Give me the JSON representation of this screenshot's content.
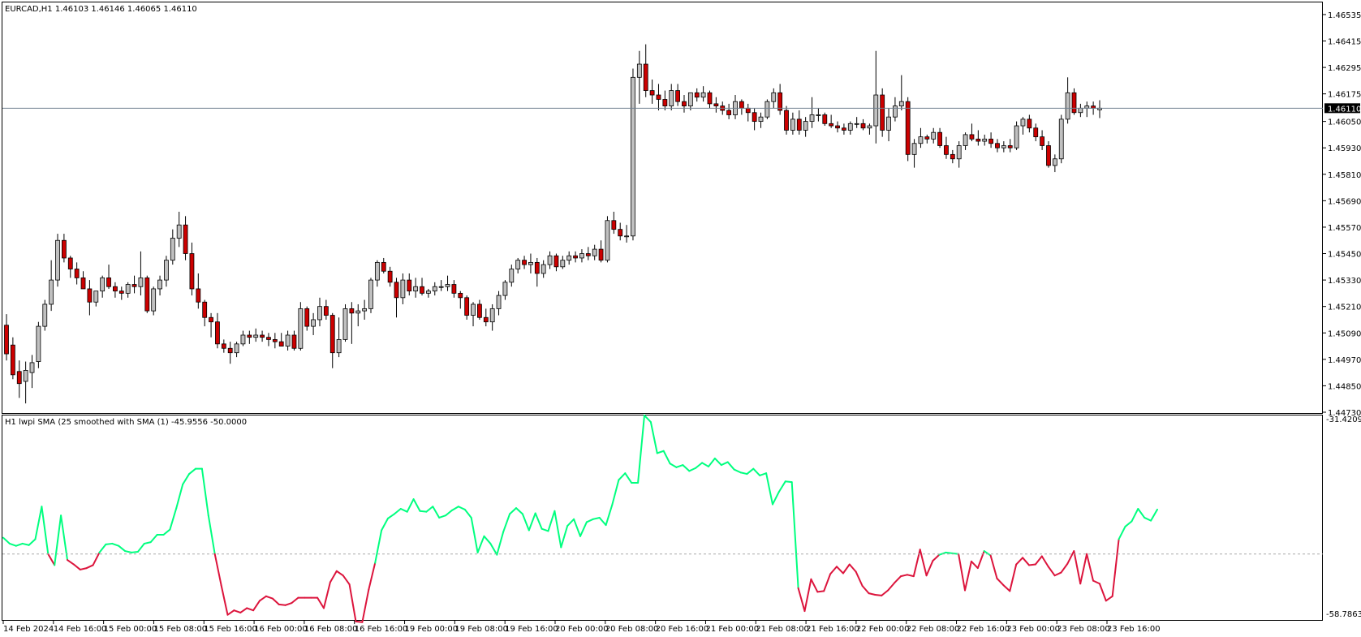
{
  "window": {
    "symbol_info": "EURCAD,H1  1.46103 1.46146 1.46065 1.46110"
  },
  "indicator": {
    "title": "H1 lwpi  SMA (25 smoothed with  SMA (1) -45.9556 -50.0000",
    "scale_max": "-31.4209",
    "scale_min": "-58.7863",
    "levels": [
      -31.4209,
      -58.7863
    ],
    "zero_level": -50.0,
    "up_color": "#00ff7f",
    "down_color": "#dc143c"
  },
  "price_axis": {
    "labels": [
      "1.46535",
      "1.46415",
      "1.46295",
      "1.46175",
      "1.46050",
      "1.45930",
      "1.45810",
      "1.45690",
      "1.45570",
      "1.45450",
      "1.45330",
      "1.45210",
      "1.45090",
      "1.44970",
      "1.44850",
      "1.44730"
    ],
    "current_price": "1.46110"
  },
  "time_axis": {
    "labels": [
      "14 Feb 2024",
      "14 Feb 16:00",
      "15 Feb 00:00",
      "15 Feb 08:00",
      "15 Feb 16:00",
      "16 Feb 00:00",
      "16 Feb 08:00",
      "16 Feb 16:00",
      "19 Feb 00:00",
      "19 Feb 08:00",
      "19 Feb 16:00",
      "20 Feb 00:00",
      "20 Feb 08:00",
      "20 Feb 16:00",
      "21 Feb 00:00",
      "21 Feb 08:00",
      "21 Feb 16:00",
      "22 Feb 00:00",
      "22 Feb 08:00",
      "22 Feb 16:00",
      "23 Feb 00:00",
      "23 Feb 08:00",
      "23 Feb 16:00"
    ]
  },
  "chart_data": {
    "type": "candlestick",
    "symbol": "EURCAD",
    "timeframe": "H1",
    "ylim": [
      1.4473,
      1.4659
    ],
    "up_color": "#c0c0c0",
    "down_color": "#cc0000",
    "candles": [
      [
        1.45125,
        1.45175,
        1.44965,
        1.44995
      ],
      [
        1.45035,
        1.4507,
        1.4488,
        1.449
      ],
      [
        1.44915,
        1.44965,
        1.44795,
        1.4486
      ],
      [
        1.4487,
        1.4496,
        1.4477,
        1.4492
      ],
      [
        1.4491,
        1.4499,
        1.4484,
        1.44955
      ],
      [
        1.4496,
        1.4514,
        1.4493,
        1.4512
      ],
      [
        1.4512,
        1.4524,
        1.451,
        1.4522
      ],
      [
        1.4522,
        1.4542,
        1.4519,
        1.4533
      ],
      [
        1.4533,
        1.4554,
        1.453,
        1.4551
      ],
      [
        1.4551,
        1.4554,
        1.4541,
        1.4543
      ],
      [
        1.4543,
        1.4544,
        1.4534,
        1.4538
      ],
      [
        1.4538,
        1.4541,
        1.4531,
        1.4534
      ],
      [
        1.4534,
        1.4537,
        1.4529,
        1.4529
      ],
      [
        1.4529,
        1.4533,
        1.4517,
        1.4523
      ],
      [
        1.4523,
        1.4528,
        1.4521,
        1.4528
      ],
      [
        1.4528,
        1.4535,
        1.4525,
        1.4534
      ],
      [
        1.4534,
        1.454,
        1.4529,
        1.453
      ],
      [
        1.453,
        1.4532,
        1.4525,
        1.4528
      ],
      [
        1.4528,
        1.453,
        1.4524,
        1.4527
      ],
      [
        1.4527,
        1.4532,
        1.4525,
        1.4531
      ],
      [
        1.4531,
        1.4535,
        1.4527,
        1.453
      ],
      [
        1.453,
        1.4546,
        1.4526,
        1.4534
      ],
      [
        1.4534,
        1.4535,
        1.4518,
        1.4519
      ],
      [
        1.4519,
        1.453,
        1.4517,
        1.4529
      ],
      [
        1.4529,
        1.4535,
        1.4526,
        1.4533
      ],
      [
        1.4533,
        1.4544,
        1.453,
        1.4542
      ],
      [
        1.4542,
        1.4556,
        1.454,
        1.4552
      ],
      [
        1.4552,
        1.4564,
        1.4548,
        1.4558
      ],
      [
        1.4558,
        1.4562,
        1.4542,
        1.4545
      ],
      [
        1.4545,
        1.455,
        1.4526,
        1.4529
      ],
      [
        1.4529,
        1.4536,
        1.452,
        1.4523
      ],
      [
        1.4523,
        1.4524,
        1.4512,
        1.4516
      ],
      [
        1.4516,
        1.4518,
        1.4507,
        1.4514
      ],
      [
        1.4514,
        1.4518,
        1.4502,
        1.4504
      ],
      [
        1.4504,
        1.4506,
        1.45,
        1.4502
      ],
      [
        1.4502,
        1.4505,
        1.4495,
        1.45
      ],
      [
        1.45,
        1.4505,
        1.4498,
        1.4504
      ],
      [
        1.4504,
        1.451,
        1.4503,
        1.4508
      ],
      [
        1.4508,
        1.451,
        1.4504,
        1.4507
      ],
      [
        1.4507,
        1.4511,
        1.4505,
        1.4508
      ],
      [
        1.4508,
        1.451,
        1.4505,
        1.4507
      ],
      [
        1.4507,
        1.4509,
        1.4503,
        1.4506
      ],
      [
        1.4506,
        1.4509,
        1.4502,
        1.4505
      ],
      [
        1.4505,
        1.4509,
        1.4503,
        1.4503
      ],
      [
        1.4503,
        1.451,
        1.4501,
        1.4508
      ],
      [
        1.4508,
        1.451,
        1.4501,
        1.4502
      ],
      [
        1.4502,
        1.4523,
        1.4501,
        1.452
      ],
      [
        1.452,
        1.4521,
        1.451,
        1.4512
      ],
      [
        1.4512,
        1.4518,
        1.4508,
        1.4515
      ],
      [
        1.4515,
        1.4525,
        1.4512,
        1.4521
      ],
      [
        1.4521,
        1.4524,
        1.4515,
        1.4517
      ],
      [
        1.4517,
        1.4518,
        1.4493,
        1.45
      ],
      [
        1.45,
        1.4516,
        1.4498,
        1.4506
      ],
      [
        1.4506,
        1.4522,
        1.4505,
        1.452
      ],
      [
        1.452,
        1.4523,
        1.4504,
        1.4518
      ],
      [
        1.4518,
        1.4522,
        1.4512,
        1.4519
      ],
      [
        1.4519,
        1.4524,
        1.4515,
        1.452
      ],
      [
        1.452,
        1.4534,
        1.4518,
        1.4533
      ],
      [
        1.4533,
        1.4542,
        1.453,
        1.4541
      ],
      [
        1.4541,
        1.4543,
        1.4536,
        1.4537
      ],
      [
        1.4537,
        1.4539,
        1.453,
        1.4532
      ],
      [
        1.4532,
        1.4534,
        1.4516,
        1.4525
      ],
      [
        1.4525,
        1.4536,
        1.4522,
        1.4533
      ],
      [
        1.4533,
        1.4536,
        1.4526,
        1.4528
      ],
      [
        1.4528,
        1.4534,
        1.4525,
        1.453
      ],
      [
        1.453,
        1.4534,
        1.4526,
        1.4527
      ],
      [
        1.4527,
        1.4529,
        1.4525,
        1.4528
      ],
      [
        1.4528,
        1.4532,
        1.4526,
        1.453
      ],
      [
        1.453,
        1.4533,
        1.4528,
        1.453
      ],
      [
        1.453,
        1.4535,
        1.4528,
        1.4531
      ],
      [
        1.4531,
        1.4533,
        1.4525,
        1.4527
      ],
      [
        1.4527,
        1.4528,
        1.452,
        1.4525
      ],
      [
        1.4525,
        1.4526,
        1.4515,
        1.4517
      ],
      [
        1.4517,
        1.4523,
        1.4512,
        1.4522
      ],
      [
        1.4522,
        1.4524,
        1.4515,
        1.4516
      ],
      [
        1.4516,
        1.452,
        1.4512,
        1.4514
      ],
      [
        1.4514,
        1.4522,
        1.451,
        1.452
      ],
      [
        1.452,
        1.4528,
        1.4517,
        1.4526
      ],
      [
        1.4526,
        1.4533,
        1.4524,
        1.4532
      ],
      [
        1.4532,
        1.454,
        1.453,
        1.4538
      ],
      [
        1.4538,
        1.4543,
        1.4536,
        1.4542
      ],
      [
        1.4542,
        1.4544,
        1.4538,
        1.454
      ],
      [
        1.454,
        1.4545,
        1.4536,
        1.4541
      ],
      [
        1.4541,
        1.4543,
        1.453,
        1.4536
      ],
      [
        1.4536,
        1.4542,
        1.4534,
        1.454
      ],
      [
        1.454,
        1.4546,
        1.4538,
        1.4544
      ],
      [
        1.4544,
        1.4545,
        1.4537,
        1.4539
      ],
      [
        1.4539,
        1.4544,
        1.4538,
        1.4542
      ],
      [
        1.4542,
        1.4546,
        1.454,
        1.4544
      ],
      [
        1.4544,
        1.4546,
        1.4541,
        1.4543
      ],
      [
        1.4543,
        1.4547,
        1.4541,
        1.4545
      ],
      [
        1.4545,
        1.4548,
        1.4542,
        1.4544
      ],
      [
        1.4544,
        1.4549,
        1.4542,
        1.4547
      ],
      [
        1.4547,
        1.4551,
        1.4541,
        1.4542
      ],
      [
        1.4542,
        1.4562,
        1.4541,
        1.456
      ],
      [
        1.456,
        1.4564,
        1.4554,
        1.4556
      ],
      [
        1.4556,
        1.4559,
        1.4551,
        1.4553
      ],
      [
        1.4553,
        1.4558,
        1.455,
        1.4553
      ],
      [
        1.4553,
        1.4629,
        1.4551,
        1.4625
      ],
      [
        1.4625,
        1.4637,
        1.4613,
        1.4631
      ],
      [
        1.4631,
        1.464,
        1.4616,
        1.4619
      ],
      [
        1.4619,
        1.4624,
        1.4613,
        1.4617
      ],
      [
        1.4617,
        1.4622,
        1.461,
        1.4615
      ],
      [
        1.4615,
        1.4619,
        1.461,
        1.4612
      ],
      [
        1.4612,
        1.4622,
        1.461,
        1.4619
      ],
      [
        1.4619,
        1.4622,
        1.4612,
        1.4614
      ],
      [
        1.4614,
        1.4617,
        1.4609,
        1.4612
      ],
      [
        1.4612,
        1.4618,
        1.461,
        1.4618
      ],
      [
        1.4618,
        1.462,
        1.4614,
        1.4616
      ],
      [
        1.4616,
        1.4621,
        1.4614,
        1.4618
      ],
      [
        1.4618,
        1.4619,
        1.4611,
        1.4613
      ],
      [
        1.4613,
        1.4616,
        1.4609,
        1.4612
      ],
      [
        1.4612,
        1.4614,
        1.4608,
        1.461
      ],
      [
        1.461,
        1.4613,
        1.4606,
        1.4608
      ],
      [
        1.4608,
        1.4617,
        1.4606,
        1.4614
      ],
      [
        1.4614,
        1.4615,
        1.4608,
        1.4611
      ],
      [
        1.4611,
        1.4613,
        1.4605,
        1.4609
      ],
      [
        1.4609,
        1.4611,
        1.4601,
        1.4605
      ],
      [
        1.4605,
        1.4609,
        1.4602,
        1.4607
      ],
      [
        1.4607,
        1.4615,
        1.4606,
        1.4614
      ],
      [
        1.4614,
        1.462,
        1.4611,
        1.4618
      ],
      [
        1.4618,
        1.4622,
        1.4608,
        1.461
      ],
      [
        1.461,
        1.4612,
        1.4599,
        1.4601
      ],
      [
        1.4601,
        1.4609,
        1.4599,
        1.4606
      ],
      [
        1.4606,
        1.461,
        1.4599,
        1.4601
      ],
      [
        1.4601,
        1.4607,
        1.4598,
        1.4605
      ],
      [
        1.4605,
        1.4616,
        1.4602,
        1.4608
      ],
      [
        1.4608,
        1.4611,
        1.4605,
        1.4608
      ],
      [
        1.4608,
        1.4609,
        1.4603,
        1.4604
      ],
      [
        1.4604,
        1.4608,
        1.4602,
        1.4603
      ],
      [
        1.4603,
        1.4605,
        1.46,
        1.4602
      ],
      [
        1.4602,
        1.4604,
        1.4599,
        1.4601
      ],
      [
        1.4601,
        1.4605,
        1.4599,
        1.4604
      ],
      [
        1.4604,
        1.4607,
        1.4602,
        1.4604
      ],
      [
        1.4604,
        1.4606,
        1.4601,
        1.4602
      ],
      [
        1.4602,
        1.4604,
        1.4599,
        1.4603
      ],
      [
        1.4603,
        1.4637,
        1.4595,
        1.4617
      ],
      [
        1.4617,
        1.462,
        1.4598,
        1.4601
      ],
      [
        1.4601,
        1.4611,
        1.4596,
        1.4607
      ],
      [
        1.4607,
        1.4616,
        1.4605,
        1.4612
      ],
      [
        1.4612,
        1.4626,
        1.461,
        1.4614
      ],
      [
        1.4614,
        1.4616,
        1.4587,
        1.459
      ],
      [
        1.459,
        1.4597,
        1.4584,
        1.4595
      ],
      [
        1.4595,
        1.4602,
        1.4593,
        1.4598
      ],
      [
        1.4598,
        1.4599,
        1.4595,
        1.4597
      ],
      [
        1.4597,
        1.4602,
        1.4595,
        1.46
      ],
      [
        1.46,
        1.4602,
        1.4593,
        1.4594
      ],
      [
        1.4594,
        1.4598,
        1.4588,
        1.459
      ],
      [
        1.459,
        1.4592,
        1.4586,
        1.4588
      ],
      [
        1.4588,
        1.4596,
        1.4584,
        1.4594
      ],
      [
        1.4594,
        1.46,
        1.4592,
        1.4599
      ],
      [
        1.4599,
        1.4604,
        1.4596,
        1.4597
      ],
      [
        1.4597,
        1.4601,
        1.4594,
        1.4596
      ],
      [
        1.4596,
        1.4599,
        1.4594,
        1.4597
      ],
      [
        1.4597,
        1.46,
        1.4593,
        1.4595
      ],
      [
        1.4595,
        1.4597,
        1.4591,
        1.4593
      ],
      [
        1.4593,
        1.4596,
        1.4591,
        1.4594
      ],
      [
        1.4594,
        1.4597,
        1.4591,
        1.4593
      ],
      [
        1.4593,
        1.4605,
        1.4592,
        1.4603
      ],
      [
        1.4603,
        1.4607,
        1.4599,
        1.4606
      ],
      [
        1.4606,
        1.4608,
        1.46,
        1.4602
      ],
      [
        1.4602,
        1.4604,
        1.4596,
        1.4598
      ],
      [
        1.4598,
        1.4601,
        1.4592,
        1.4594
      ],
      [
        1.4594,
        1.4596,
        1.4584,
        1.4585
      ],
      [
        1.4585,
        1.459,
        1.4582,
        1.4588
      ],
      [
        1.4588,
        1.4608,
        1.4586,
        1.4606
      ],
      [
        1.4606,
        1.4625,
        1.4604,
        1.4618
      ],
      [
        1.4618,
        1.462,
        1.4608,
        1.4609
      ],
      [
        1.4609,
        1.4613,
        1.4607,
        1.4611
      ],
      [
        1.4611,
        1.4614,
        1.4607,
        1.4612
      ],
      [
        1.4612,
        1.4614,
        1.4608,
        1.4611
      ],
      [
        1.46103,
        1.46146,
        1.46065,
        1.4611
      ]
    ],
    "indicator_series": {
      "name": "lwpi",
      "values": [
        -47.8,
        -48.6,
        -48.9,
        -48.6,
        -48.8,
        -48.0,
        -43.6,
        -50.0,
        -51.5,
        -44.8,
        -50.8,
        -51.4,
        -52.1,
        -51.9,
        -51.5,
        -49.8,
        -48.7,
        -48.6,
        -48.9,
        -49.6,
        -49.8,
        -49.7,
        -48.6,
        -48.4,
        -47.4,
        -47.4,
        -46.7,
        -43.8,
        -40.6,
        -39.2,
        -38.5,
        -38.5,
        -44.8,
        -50.0,
        -54.2,
        -58.2,
        -57.6,
        -57.9,
        -57.3,
        -57.6,
        -56.3,
        -55.7,
        -56.0,
        -56.8,
        -56.9,
        -56.6,
        -55.9,
        -55.9,
        -55.9,
        -55.9,
        -57.3,
        -53.8,
        -52.3,
        -52.9,
        -54.1,
        -59.1,
        -59.2,
        -54.8,
        -51.2,
        -46.8,
        -45.2,
        -44.6,
        -43.9,
        -44.3,
        -42.6,
        -44.2,
        -44.3,
        -43.6,
        -45.1,
        -44.8,
        -44.1,
        -43.6,
        -44.0,
        -45.1,
        -49.8,
        -47.6,
        -48.6,
        -50.1,
        -47.0,
        -44.6,
        -43.8,
        -44.6,
        -46.8,
        -44.5,
        -46.6,
        -46.9,
        -44.2,
        -49.1,
        -46.2,
        -45.3,
        -47.6,
        -45.7,
        -45.3,
        -45.1,
        -46.1,
        -43.3,
        -40.0,
        -39.1,
        -40.4,
        -40.4,
        -31.3,
        -32.2,
        -36.4,
        -36.1,
        -37.8,
        -38.3,
        -38.0,
        -38.8,
        -38.4,
        -37.7,
        -38.2,
        -37.1,
        -38.0,
        -37.6,
        -38.6,
        -39.0,
        -39.2,
        -38.5,
        -39.4,
        -39.1,
        -43.3,
        -41.6,
        -40.2,
        -40.3,
        -54.6,
        -57.7,
        -53.4,
        -55.1,
        -55.0,
        -52.7,
        -51.7,
        -52.6,
        -51.4,
        -52.4,
        -54.3,
        -55.3,
        -55.5,
        -55.6,
        -54.9,
        -53.9,
        -53.0,
        -52.8,
        -53.0,
        -49.4,
        -52.9,
        -50.9,
        -50.1,
        -49.8,
        -49.9,
        -50.0,
        -54.9,
        -51.0,
        -51.9,
        -49.6,
        -50.2,
        -53.3,
        -54.2,
        -55.0,
        -51.4,
        -50.5,
        -51.5,
        -51.4,
        -50.3,
        -51.7,
        -52.9,
        -52.5,
        -51.3,
        -49.6,
        -54.0,
        -50.0,
        -53.6,
        -54.0,
        -56.3,
        -55.7,
        -48.0,
        -46.3,
        -45.6,
        -43.9,
        -45.1,
        -45.5,
        -44.0
      ]
    }
  }
}
